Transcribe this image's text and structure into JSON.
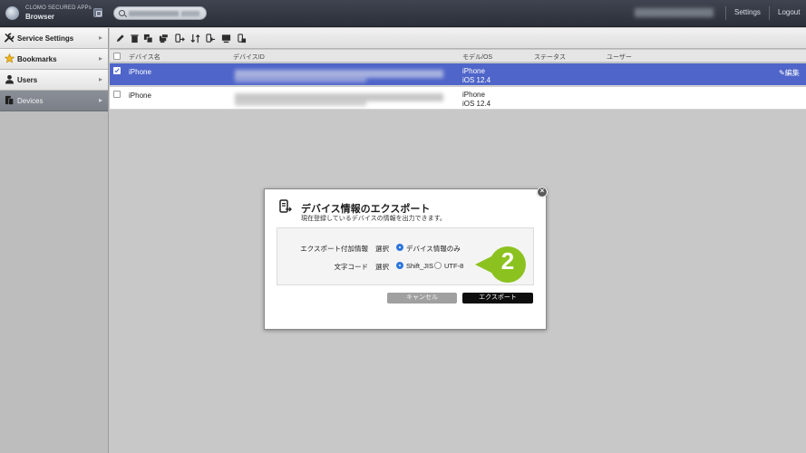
{
  "app": {
    "subtitle": "CLOMO SECURED APPs",
    "name": "Browser"
  },
  "header": {
    "settings_label": "Settings",
    "logout_label": "Logout"
  },
  "sidebar": {
    "items": [
      {
        "label": "Service Settings",
        "icon": "wrench-icon"
      },
      {
        "label": "Bookmarks",
        "icon": "star-icon"
      },
      {
        "label": "Users",
        "icon": "user-icon"
      },
      {
        "label": "Devices",
        "icon": "device-icon"
      }
    ]
  },
  "table": {
    "headers": {
      "name": "デバイス名",
      "device_id": "デバイスID",
      "model_os": "モデル/OS",
      "status": "ステータス",
      "user": "ユーザー"
    },
    "rows": [
      {
        "name": "iPhone",
        "model": "iPhone",
        "os": "iOS 12.4",
        "selected": true
      },
      {
        "name": "iPhone",
        "model": "iPhone",
        "os": "iOS 12.4",
        "selected": false
      }
    ],
    "edit_label": "編集"
  },
  "dialog": {
    "title": "デバイス情報のエクスポート",
    "subtitle": "現在登録しているデバイスの情報を出力できます。",
    "field1_label": "エクスポート付加情報",
    "field1_select": "選択",
    "field1_option": "デバイス情報のみ",
    "field2_label": "文字コード",
    "field2_select": "選択",
    "field2_option_a": "Shift_JIS",
    "field2_option_b": "UTF-8",
    "cancel_label": "キャンセル",
    "export_label": "エクスポート"
  },
  "callout": {
    "number": "2",
    "color": "#8cc21f"
  },
  "colors": {
    "selected_row": "#4f65c9",
    "radio_on": "#2d76dd"
  }
}
